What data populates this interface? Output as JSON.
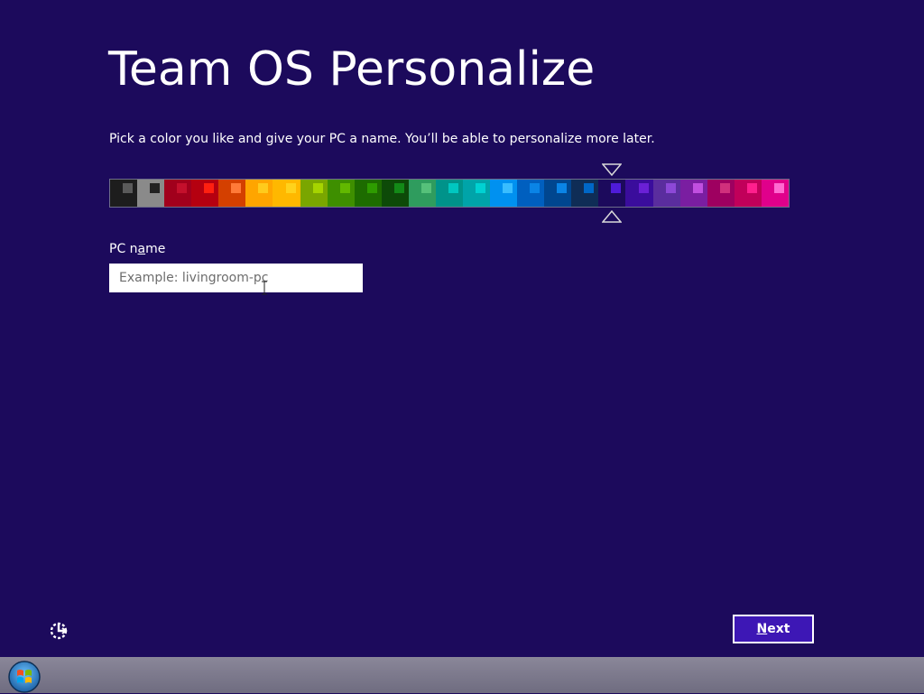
{
  "header": {
    "title": "Team OS Personalize",
    "subtitle": "Pick a color you like and give your PC a name. You’ll be able to personalize more later."
  },
  "palette": {
    "selected_index": 18,
    "swatches": [
      {
        "bg": "#1d1d1d",
        "chip": "#5a5a5a"
      },
      {
        "bg": "#8a8a8a",
        "chip": "#222222"
      },
      {
        "bg": "#a1001c",
        "chip": "#c4102c"
      },
      {
        "bg": "#b50010",
        "chip": "#ff2010"
      },
      {
        "bg": "#d44000",
        "chip": "#ff7a38"
      },
      {
        "bg": "#ffa500",
        "chip": "#ffcb1c"
      },
      {
        "bg": "#ffb800",
        "chip": "#ffd21c"
      },
      {
        "bg": "#7aa600",
        "chip": "#a6d400"
      },
      {
        "bg": "#3e8f00",
        "chip": "#62b800"
      },
      {
        "bg": "#1d6c00",
        "chip": "#2e9c00"
      },
      {
        "bg": "#0d4a08",
        "chip": "#138a17"
      },
      {
        "bg": "#2f9c5e",
        "chip": "#56c17a"
      },
      {
        "bg": "#00938a",
        "chip": "#00c7c0"
      },
      {
        "bg": "#00a4a9",
        "chip": "#00d2d2"
      },
      {
        "bg": "#0091f0",
        "chip": "#39bdff"
      },
      {
        "bg": "#005fbf",
        "chip": "#0a84e6"
      },
      {
        "bg": "#00468f",
        "chip": "#0a84e6"
      },
      {
        "bg": "#0f2d56",
        "chip": "#0067c7"
      },
      {
        "bg": "#1c0a5c",
        "chip": "#4f1bd9"
      },
      {
        "bg": "#3a0d9c",
        "chip": "#6a20d6"
      },
      {
        "bg": "#5a2d9e",
        "chip": "#8c48d7"
      },
      {
        "bg": "#7a1ea1",
        "chip": "#c14fe0"
      },
      {
        "bg": "#9e0060",
        "chip": "#d0307c"
      },
      {
        "bg": "#c1005a",
        "chip": "#ff1f8d"
      },
      {
        "bg": "#e0008b",
        "chip": "#ff6ad1"
      }
    ]
  },
  "pc_name": {
    "label_pre": "PC n",
    "label_acc": "a",
    "label_post": "me",
    "placeholder": "Example: livingroom-pc",
    "value": ""
  },
  "next_button": {
    "acc": "N",
    "rest": "ext"
  },
  "theme": {
    "background": "#1c0a5c",
    "button_bg": "#3d17b5"
  }
}
